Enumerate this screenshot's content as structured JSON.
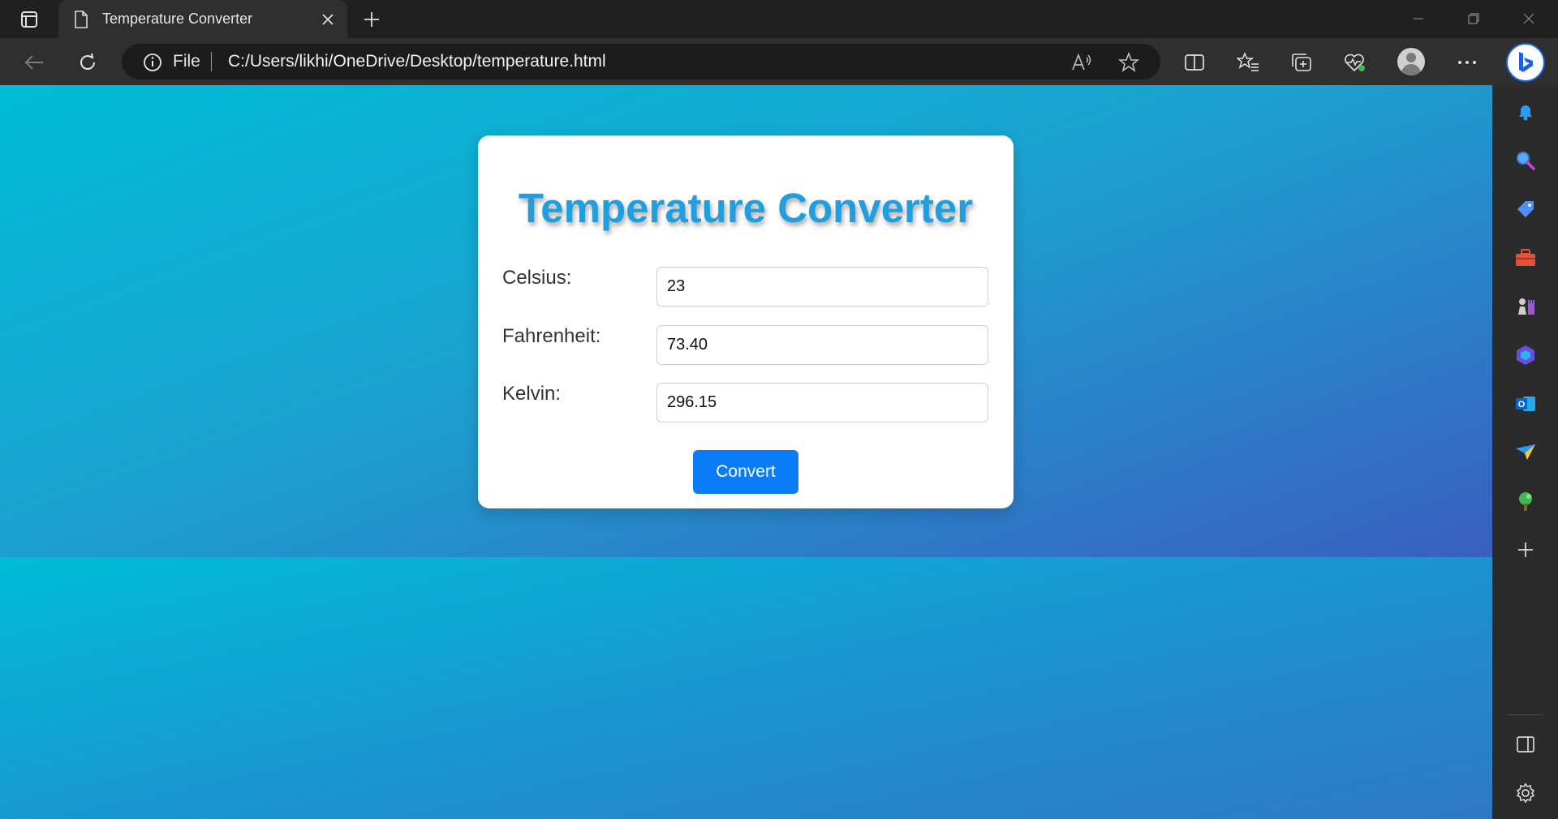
{
  "browser": {
    "tab": {
      "title": "Temperature Converter"
    },
    "address": {
      "scheme_label": "File",
      "url": "C:/Users/likhi/OneDrive/Desktop/temperature.html"
    }
  },
  "page": {
    "heading": "Temperature Converter",
    "fields": [
      {
        "label": "Celsius:",
        "value": "23"
      },
      {
        "label": "Fahrenheit:",
        "value": "73.40"
      },
      {
        "label": "Kelvin:",
        "value": "296.15"
      }
    ],
    "convert_label": "Convert"
  },
  "colors": {
    "heading": "#1f9fe0",
    "button": "#0a7cf7",
    "gradient_start": "#00bcd7",
    "gradient_end": "#3a5fc0"
  },
  "sidebar_icons": [
    "bell-icon",
    "search-icon",
    "tag-icon",
    "toolbox-icon",
    "games-icon",
    "copilot-icon",
    "outlook-icon",
    "send-icon",
    "tree-icon",
    "add-icon",
    "sidebar-panel-icon",
    "settings-icon"
  ]
}
